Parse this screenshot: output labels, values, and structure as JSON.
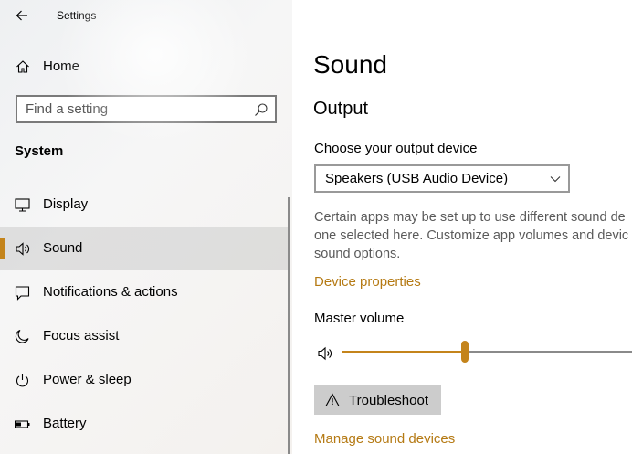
{
  "window": {
    "title": "Settings"
  },
  "sidebar": {
    "home_label": "Home",
    "search": {
      "placeholder": "Find a setting"
    },
    "section_title": "System",
    "items": [
      {
        "label": "Display",
        "icon": "monitor-icon"
      },
      {
        "label": "Sound",
        "icon": "speaker-icon",
        "selected": true
      },
      {
        "label": "Notifications & actions",
        "icon": "notification-icon"
      },
      {
        "label": "Focus assist",
        "icon": "moon-icon"
      },
      {
        "label": "Power & sleep",
        "icon": "power-icon"
      },
      {
        "label": "Battery",
        "icon": "battery-icon"
      }
    ]
  },
  "main": {
    "title": "Sound",
    "output": {
      "heading": "Output",
      "device_label": "Choose your output device",
      "device_value": "Speakers (USB Audio Device)",
      "description_lines": [
        "Certain apps may be set up to use different sound de",
        "one selected here. Customize app volumes and devic",
        "sound options."
      ],
      "device_properties_link": "Device properties",
      "master_volume_label": "Master volume",
      "master_volume_level": 0.41,
      "troubleshoot_label": "Troubleshoot",
      "manage_devices_link": "Manage sound devices"
    }
  },
  "colors": {
    "accent": "#c4841b",
    "link": "#b57a14",
    "selected_bg": "#e6e6e6",
    "button_bg": "#cccccc"
  }
}
